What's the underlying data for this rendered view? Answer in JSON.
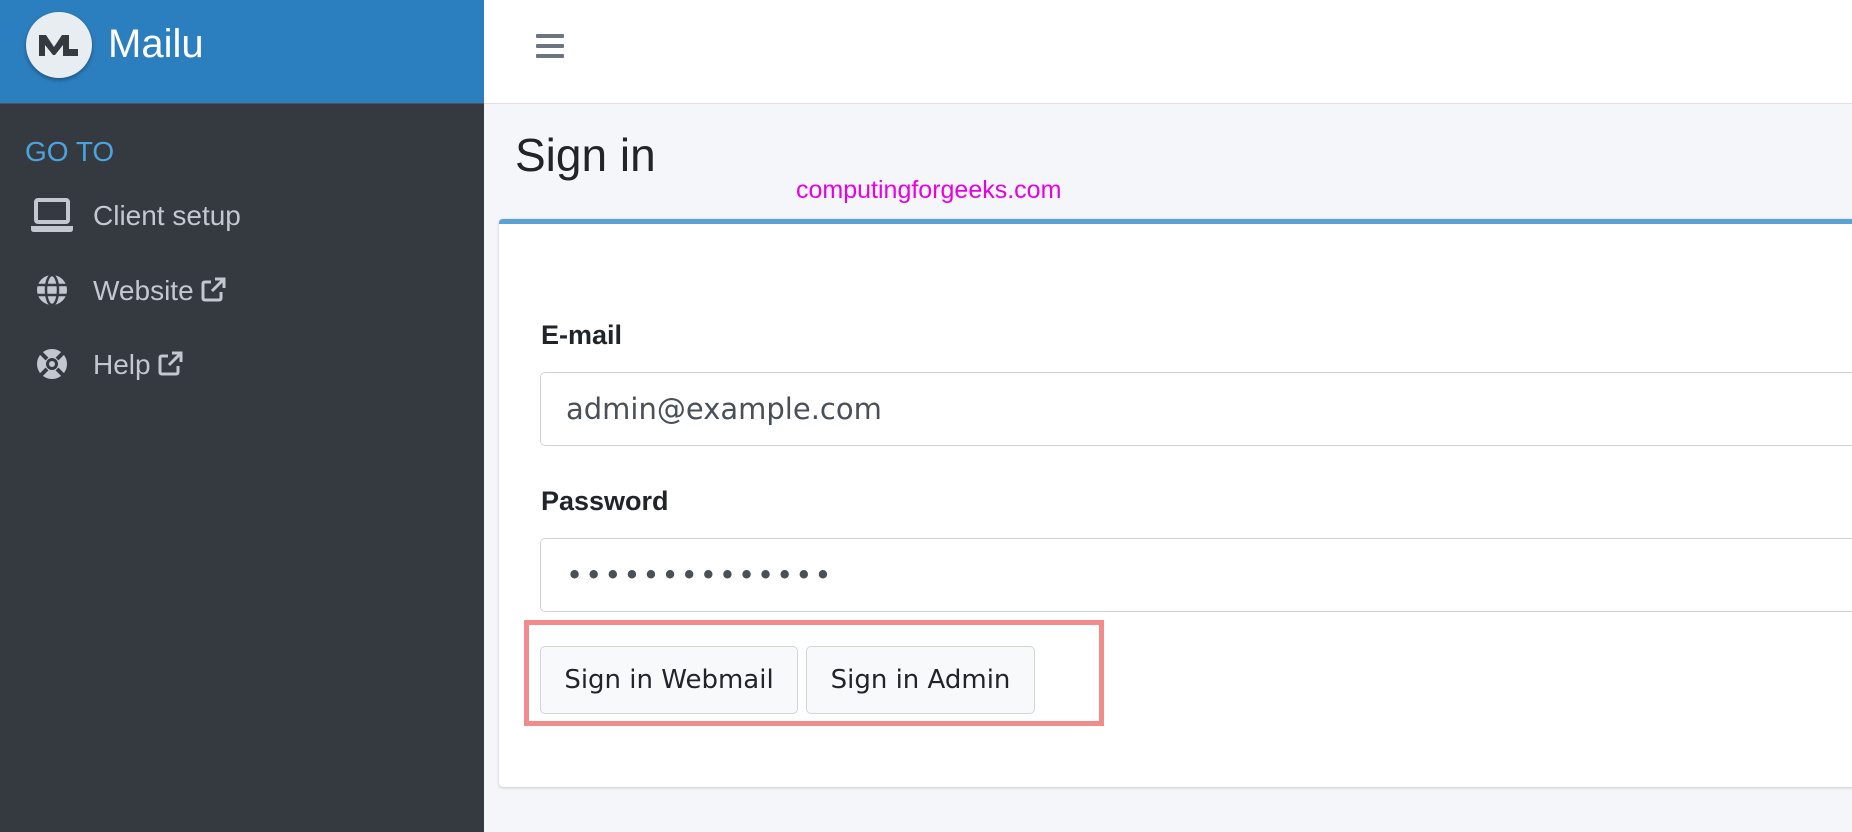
{
  "app": {
    "name": "Mailu"
  },
  "sidebar": {
    "header": "GO TO",
    "items": [
      {
        "label": "Client setup",
        "icon": "laptop-icon"
      },
      {
        "label": "Website",
        "icon": "globe-icon",
        "external": true
      },
      {
        "label": "Help",
        "icon": "life-ring-icon",
        "external": true
      }
    ]
  },
  "page": {
    "title": "Sign in"
  },
  "watermark": "computingforgeeks.com",
  "form": {
    "email": {
      "label": "E-mail",
      "value": "admin@example.com"
    },
    "password": {
      "label": "Password",
      "value": "••••••••••••••"
    },
    "buttons": {
      "webmail": "Sign in Webmail",
      "admin": "Sign in Admin"
    }
  },
  "colors": {
    "brand": "#2c7fbf",
    "sidebar": "#343a40",
    "nav_header": "#4ca3dd",
    "card_accent": "#5aa2d4",
    "watermark": "#e600e6",
    "highlight": "#f28b8c"
  }
}
